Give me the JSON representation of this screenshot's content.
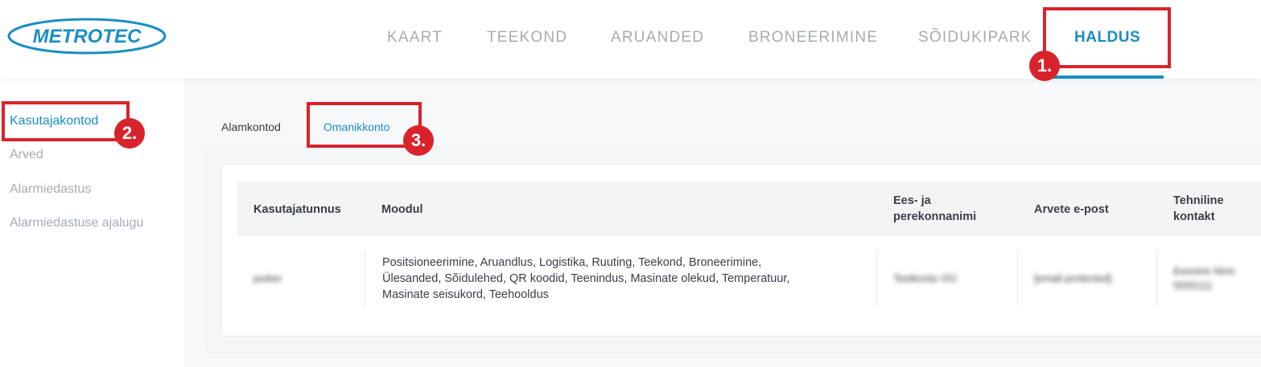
{
  "header": {
    "logo_text": "METROTEC",
    "nav": [
      {
        "label": "KAART"
      },
      {
        "label": "TEEKOND"
      },
      {
        "label": "ARUANDED"
      },
      {
        "label": "BRONEERIMINE"
      },
      {
        "label": "SÕIDUKIPARK"
      },
      {
        "label": "HALDUS",
        "active": true
      }
    ]
  },
  "sidebar": {
    "items": [
      {
        "label": "Kasutajakontod",
        "active": true
      },
      {
        "label": "Arved"
      },
      {
        "label": "Alarmiedastus"
      },
      {
        "label": "Alarmiedastuse ajalugu"
      }
    ]
  },
  "tabs": [
    {
      "label": "Alamkontod"
    },
    {
      "label": "Omanikkonto",
      "active": true
    }
  ],
  "table": {
    "headers": {
      "username": "Kasutajatunnus",
      "module": "Moodul",
      "name_line1": "Ees- ja",
      "name_line2": "perekonnanimi",
      "email": "Arvete e-post",
      "tech_line1": "Tehniline",
      "tech_line2": "kontakt"
    },
    "row": {
      "username": "jooker",
      "module_line1": "Positsioneerimine, Aruandlus, Logistika, Ruuting, Teekond, Broneerimine,",
      "module_line2": "Ülesanded, Sõidulehed, QR koodid, Teenindus, Masinate olekud, Temperatuur,",
      "module_line3": "Masinate seisukord, Teehooldus",
      "name": "Testkonto OÜ",
      "email": "[email protected]",
      "tech_line1": "Eesnimi Nimi",
      "tech_line2": "5555111"
    }
  },
  "annotations": {
    "badge1": "1.",
    "badge2": "2.",
    "badge3": "3."
  },
  "colors": {
    "accent": "#1a8ec3",
    "highlight": "#d9232b",
    "inactive_text": "#a6acb3"
  }
}
